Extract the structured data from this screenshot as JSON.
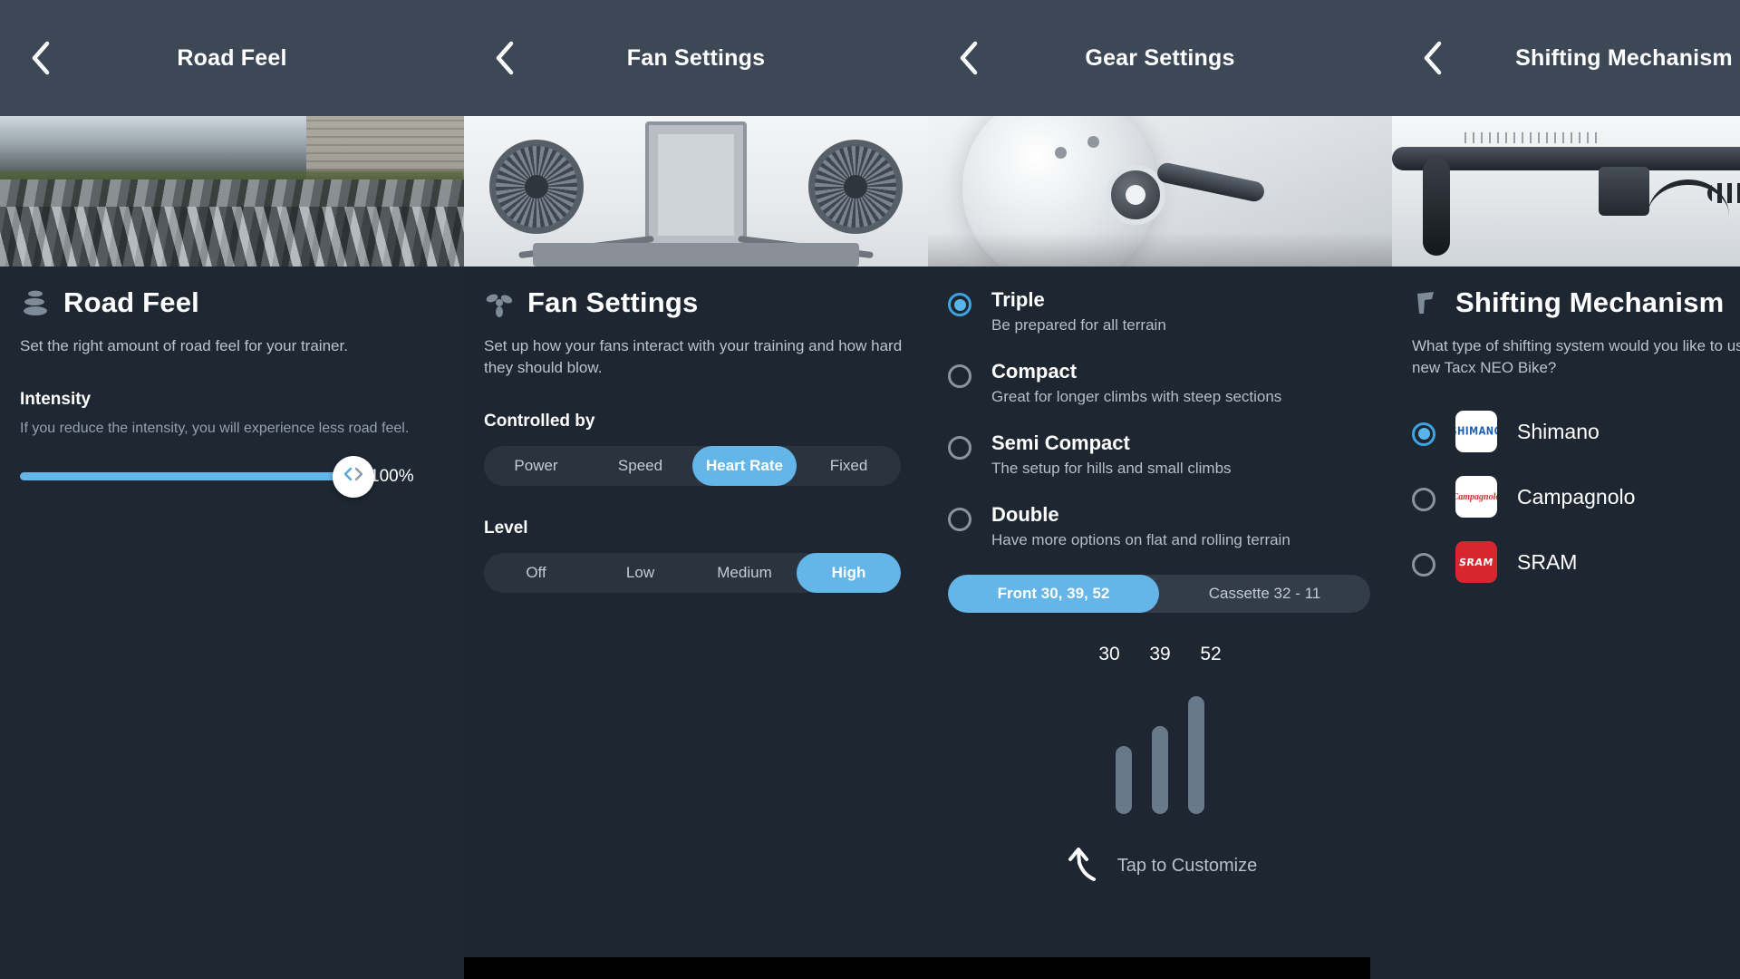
{
  "theme": {
    "accent": "#64b5e8",
    "bg": "#1f2733",
    "navbar_bg": "#3c4856",
    "segment_bg": "#2b333f",
    "bar_color": "#68798c"
  },
  "panels": [
    {
      "nav": {
        "back_icon": "chevron-left-icon",
        "title": "Road Feel"
      },
      "hero_icon": "wet-cobblestone-road-photo",
      "title_icon": "stacked-stones-icon",
      "title": "Road Feel",
      "description": "Set the right amount of road feel for your trainer.",
      "section_label": "Intensity",
      "section_desc": "If you reduce the intensity, you will experience less road feel.",
      "slider": {
        "value_label": "100%",
        "percent": 100,
        "thumb_icon": "left-right-chevrons-icon"
      }
    },
    {
      "nav": {
        "back_icon": "chevron-left-icon",
        "title": "Fan Settings"
      },
      "hero_icon": "twin-fans-with-tablet-photo",
      "title_icon": "fan-propeller-icon",
      "title": "Fan Settings",
      "description": "Set up how your fans interact with your training and how hard they should blow.",
      "groups": [
        {
          "label": "Controlled by",
          "options": [
            "Power",
            "Speed",
            "Heart Rate",
            "Fixed"
          ],
          "selected": "Heart Rate"
        },
        {
          "label": "Level",
          "options": [
            "Off",
            "Low",
            "Medium",
            "High"
          ],
          "selected": "High"
        }
      ]
    },
    {
      "nav": {
        "back_icon": "chevron-left-icon",
        "title": "Gear Settings"
      },
      "hero_icon": "trainer-flywheel-crank-photo",
      "options": [
        {
          "title": "Triple",
          "subtitle": "Be prepared for all terrain",
          "selected": true
        },
        {
          "title": "Compact",
          "subtitle": "Great for longer climbs with steep sections",
          "selected": false
        },
        {
          "title": "Semi Compact",
          "subtitle": "The setup for hills and small climbs",
          "selected": false
        },
        {
          "title": "Double",
          "subtitle": "Have more options on flat and rolling terrain",
          "selected": false
        }
      ],
      "gear_toggle": {
        "options": [
          "Front 30, 39, 52",
          "Cassette 32 - 11"
        ],
        "selected": "Front 30, 39, 52"
      },
      "chart_data": {
        "type": "bar",
        "title": "",
        "categories": [
          "30",
          "39",
          "52"
        ],
        "values": [
          30,
          39,
          52
        ],
        "ylim": [
          0,
          60
        ],
        "xlabel": "",
        "ylabel": "",
        "grid": false,
        "legend": "none",
        "labels_position": "top"
      },
      "customize": {
        "icon": "curved-up-arrow-icon",
        "text": "Tap to Customize"
      }
    },
    {
      "nav": {
        "back_icon": "chevron-left-icon",
        "title": "Shifting Mechanism"
      },
      "hero_icon": "handlebar-cockpit-photo",
      "title_icon": "shifter-lever-icon",
      "title": "Shifting Mechanism",
      "description": "What type of shifting system would you like to use with your new Tacx NEO Bike?",
      "brands": [
        {
          "name": "Shimano",
          "logo_text": "SHIMANO",
          "logo_style": "white",
          "selected": true
        },
        {
          "name": "Campagnolo",
          "logo_text": "Campagnolo",
          "logo_style": "white",
          "selected": false
        },
        {
          "name": "SRAM",
          "logo_text": "SRAM",
          "logo_style": "red",
          "selected": false
        }
      ]
    }
  ]
}
